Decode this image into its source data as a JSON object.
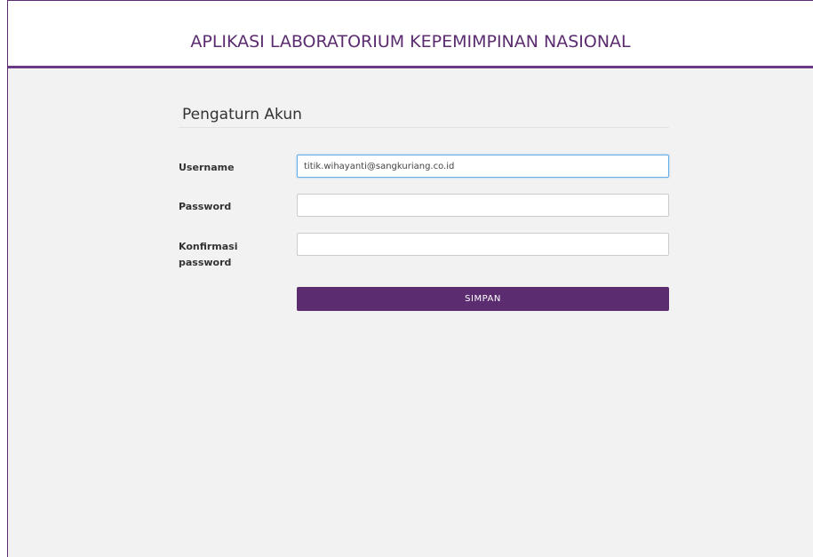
{
  "header": {
    "app_title": "APLIKASI LABORATORIUM KEPEMIMPINAN NASIONAL"
  },
  "form": {
    "title": "Pengaturn Akun",
    "fields": [
      {
        "label": "Username",
        "value": "titik.wihayanti@sangkuriang.co.id",
        "placeholder": ""
      },
      {
        "label": "Password",
        "value": "",
        "placeholder": ""
      },
      {
        "label": "Konfirmasi password",
        "value": "",
        "placeholder": ""
      }
    ],
    "submit_label": "SIMPAN"
  },
  "colors": {
    "accent": "#5b2c6f",
    "background": "#f2f2f2",
    "focus_border": "#66aee6"
  }
}
